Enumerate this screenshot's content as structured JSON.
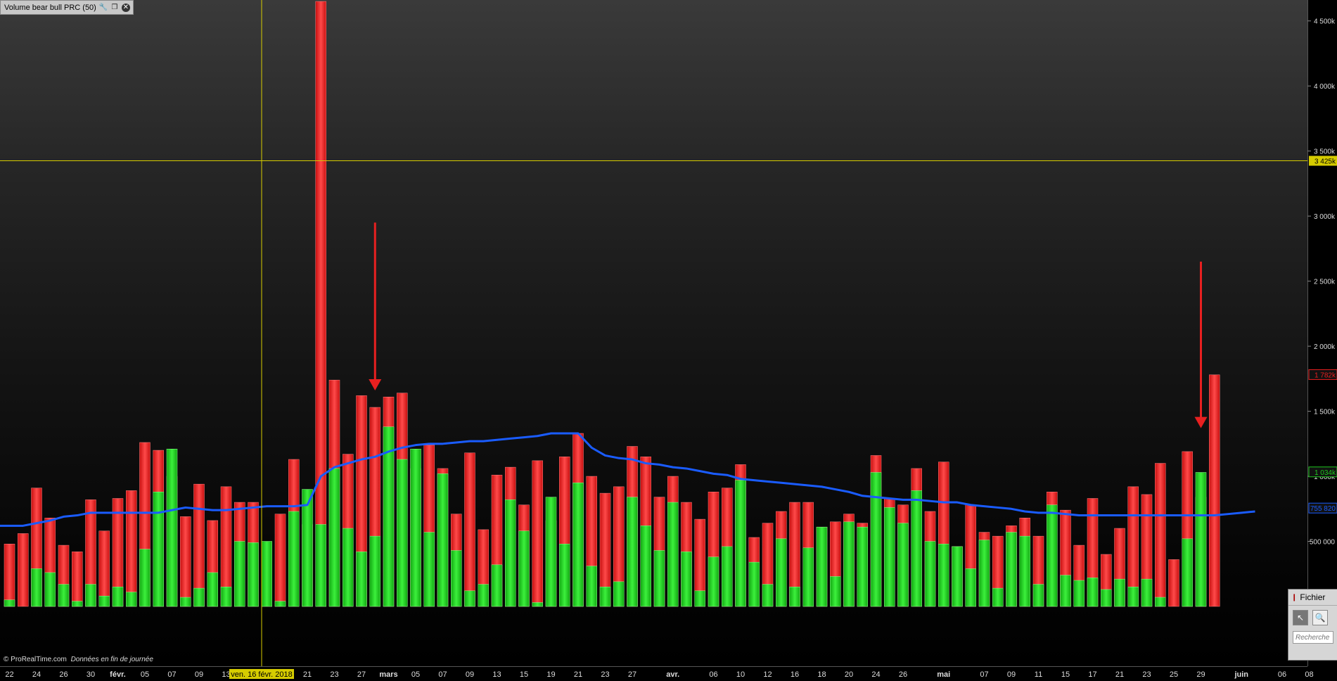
{
  "window": {
    "title": "Volume  bear bull PRC (50)",
    "icons": [
      "wrench-icon",
      "restore-window-icon",
      "close-icon"
    ]
  },
  "footer": {
    "copyright": "© ProRealTime.com",
    "source_note": "Données en fin de journée"
  },
  "side_panel": {
    "menu_label": "Fichier",
    "search_placeholder": "Recherche"
  },
  "colors": {
    "bull": "#1ec81e",
    "bear": "#e82020",
    "moving_average": "#1a5cff",
    "crosshair": "#d6cc00"
  },
  "crosshair": {
    "value_label": "3 425k",
    "date_label": "ven. 16 févr. 2018"
  },
  "chart_data": {
    "type": "bar",
    "subtype": "stacked",
    "y_axis": {
      "min": 0,
      "max": 4650,
      "ticks": [
        500,
        1000,
        1500,
        2000,
        2500,
        3000,
        3500,
        4000,
        4500
      ],
      "tick_labels": [
        "500 000",
        "1 000k",
        "1 500k",
        "2 000k",
        "2 500k",
        "3 000k",
        "3 500k",
        "4 000k",
        "4 500k"
      ],
      "value_badges": [
        {
          "text": "1 782k",
          "value": 1782,
          "color": "#e82020"
        },
        {
          "text": "1 034k",
          "value": 1034,
          "color": "#1ec81e"
        },
        {
          "text": "755 820",
          "value": 756,
          "color": "#1a5cff"
        }
      ]
    },
    "x_axis_labels": [
      {
        "label": "22",
        "index": 0
      },
      {
        "label": "24",
        "index": 2
      },
      {
        "label": "26",
        "index": 4
      },
      {
        "label": "30",
        "index": 6
      },
      {
        "label": "févr.",
        "index": 8,
        "bold": true
      },
      {
        "label": "05",
        "index": 10
      },
      {
        "label": "07",
        "index": 12
      },
      {
        "label": "09",
        "index": 14
      },
      {
        "label": "13",
        "index": 16
      },
      {
        "label": "21",
        "index": 22
      },
      {
        "label": "23",
        "index": 24
      },
      {
        "label": "27",
        "index": 26
      },
      {
        "label": "mars",
        "index": 28,
        "bold": true
      },
      {
        "label": "05",
        "index": 30
      },
      {
        "label": "07",
        "index": 32
      },
      {
        "label": "09",
        "index": 34
      },
      {
        "label": "13",
        "index": 36
      },
      {
        "label": "15",
        "index": 38
      },
      {
        "label": "19",
        "index": 40
      },
      {
        "label": "21",
        "index": 42
      },
      {
        "label": "23",
        "index": 44
      },
      {
        "label": "27",
        "index": 46
      },
      {
        "label": "avr.",
        "index": 49,
        "bold": true
      },
      {
        "label": "06",
        "index": 52
      },
      {
        "label": "10",
        "index": 54
      },
      {
        "label": "12",
        "index": 56
      },
      {
        "label": "16",
        "index": 58
      },
      {
        "label": "18",
        "index": 60
      },
      {
        "label": "20",
        "index": 62
      },
      {
        "label": "24",
        "index": 64
      },
      {
        "label": "26",
        "index": 66
      },
      {
        "label": "mai",
        "index": 69,
        "bold": true
      },
      {
        "label": "07",
        "index": 72
      },
      {
        "label": "09",
        "index": 74
      },
      {
        "label": "11",
        "index": 76
      },
      {
        "label": "15",
        "index": 78
      },
      {
        "label": "17",
        "index": 80
      },
      {
        "label": "21",
        "index": 82
      },
      {
        "label": "23",
        "index": 84
      },
      {
        "label": "25",
        "index": 86
      },
      {
        "label": "29",
        "index": 88
      },
      {
        "label": "juin",
        "index": 91,
        "bold": true
      },
      {
        "label": "06",
        "index": 94
      },
      {
        "label": "08",
        "index": 96
      }
    ],
    "series": [
      {
        "values_total": [
          480,
          560,
          910,
          680,
          470,
          420,
          820,
          580,
          830,
          890,
          1260,
          1200,
          1000,
          690,
          940,
          660,
          920,
          800,
          800,
          360,
          710,
          1130,
          630,
          4650,
          1740,
          1170,
          1620,
          1530,
          1610,
          1640,
          1060,
          1240,
          1060,
          710,
          1180,
          590,
          1010,
          1070,
          780,
          1120,
          660,
          1150,
          1330,
          1000,
          870,
          920,
          1230,
          1150,
          840,
          1000,
          800,
          670,
          880,
          910,
          1090,
          530,
          640,
          730,
          800,
          800,
          610,
          650,
          710,
          640,
          1160,
          830,
          780,
          1060,
          730,
          1110,
          460,
          780,
          570,
          540,
          620,
          680,
          540,
          880,
          740,
          470,
          830,
          400,
          600,
          920,
          860,
          1100,
          360,
          1190,
          840,
          1780
        ],
        "values_green": [
          50,
          0,
          290,
          260,
          170,
          40,
          170,
          80,
          150,
          110,
          440,
          880,
          1210,
          70,
          140,
          260,
          150,
          500,
          490,
          500,
          40,
          730,
          900,
          630,
          1060,
          600,
          420,
          540,
          1380,
          1130,
          1210,
          570,
          1020,
          430,
          120,
          170,
          320,
          820,
          580,
          30,
          840,
          480,
          950,
          310,
          150,
          190,
          840,
          620,
          430,
          800,
          420,
          120,
          380,
          460,
          970,
          340,
          170,
          520,
          150,
          450,
          610,
          230,
          650,
          610,
          1030,
          760,
          640,
          890,
          500,
          480,
          460,
          290,
          510,
          140,
          570,
          540,
          170,
          780,
          240,
          200,
          220,
          130,
          210,
          150,
          210,
          70,
          0,
          520,
          1030
        ]
      }
    ],
    "moving_average": {
      "period": 50,
      "values": [
        620,
        620,
        640,
        660,
        690,
        700,
        720,
        720,
        720,
        720,
        720,
        720,
        740,
        760,
        750,
        740,
        740,
        750,
        760,
        770,
        770,
        770,
        780,
        1000,
        1070,
        1100,
        1130,
        1150,
        1190,
        1220,
        1240,
        1250,
        1250,
        1260,
        1270,
        1270,
        1280,
        1290,
        1300,
        1310,
        1330,
        1330,
        1330,
        1220,
        1160,
        1140,
        1130,
        1100,
        1090,
        1070,
        1060,
        1040,
        1020,
        1010,
        980,
        970,
        960,
        950,
        940,
        930,
        920,
        900,
        880,
        850,
        840,
        830,
        820,
        820,
        810,
        800,
        800,
        780,
        770,
        760,
        750,
        730,
        720,
        720,
        710,
        700,
        700,
        700,
        700,
        700,
        700,
        700,
        700,
        700,
        700,
        700,
        710,
        720,
        730
      ]
    },
    "arrows": [
      {
        "index": 27,
        "from_value": 2950,
        "to_value": 1660
      },
      {
        "index": 88,
        "from_value": 2650,
        "to_value": 1370
      }
    ]
  }
}
